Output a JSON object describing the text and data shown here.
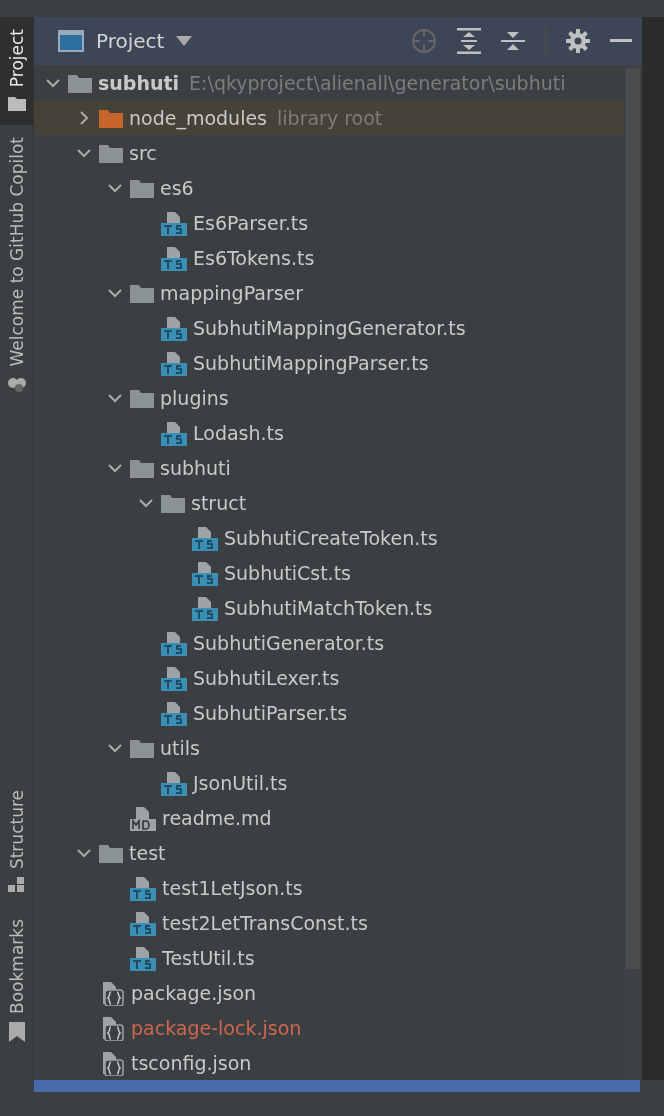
{
  "side_tabs_top": [
    {
      "label": "Project",
      "selected": true
    },
    {
      "label": "Welcome to GitHub Copilot",
      "selected": false
    }
  ],
  "side_tabs_bottom": [
    {
      "label": "Structure",
      "selected": false
    },
    {
      "label": "Bookmarks",
      "selected": false
    }
  ],
  "panel": {
    "title": "Project"
  },
  "tree": [
    {
      "kind": "folder",
      "name": "subhuti",
      "bold": true,
      "hint": "E:\\qkyproject\\alienall\\generator\\subhuti",
      "expanded": true,
      "children": [
        {
          "kind": "library",
          "name": "node_modules",
          "hint": "library root",
          "expanded": false,
          "highlighted": true
        },
        {
          "kind": "folder",
          "name": "src",
          "expanded": true,
          "children": [
            {
              "kind": "folder",
              "name": "es6",
              "expanded": true,
              "children": [
                {
                  "kind": "ts",
                  "name": "Es6Parser.ts"
                },
                {
                  "kind": "ts",
                  "name": "Es6Tokens.ts"
                }
              ]
            },
            {
              "kind": "folder",
              "name": "mappingParser",
              "expanded": true,
              "children": [
                {
                  "kind": "ts",
                  "name": "SubhutiMappingGenerator.ts"
                },
                {
                  "kind": "ts",
                  "name": "SubhutiMappingParser.ts"
                }
              ]
            },
            {
              "kind": "folder",
              "name": "plugins",
              "expanded": true,
              "children": [
                {
                  "kind": "ts",
                  "name": "Lodash.ts"
                }
              ]
            },
            {
              "kind": "folder",
              "name": "subhuti",
              "expanded": true,
              "children": [
                {
                  "kind": "folder",
                  "name": "struct",
                  "expanded": true,
                  "children": [
                    {
                      "kind": "ts",
                      "name": "SubhutiCreateToken.ts"
                    },
                    {
                      "kind": "ts",
                      "name": "SubhutiCst.ts"
                    },
                    {
                      "kind": "ts",
                      "name": "SubhutiMatchToken.ts"
                    }
                  ]
                },
                {
                  "kind": "ts",
                  "name": "SubhutiGenerator.ts"
                },
                {
                  "kind": "ts",
                  "name": "SubhutiLexer.ts"
                },
                {
                  "kind": "ts",
                  "name": "SubhutiParser.ts"
                }
              ]
            },
            {
              "kind": "folder",
              "name": "utils",
              "expanded": true,
              "children": [
                {
                  "kind": "ts",
                  "name": "JsonUtil.ts"
                }
              ]
            },
            {
              "kind": "md",
              "name": "readme.md"
            }
          ]
        },
        {
          "kind": "folder",
          "name": "test",
          "expanded": true,
          "children": [
            {
              "kind": "ts",
              "name": "test1LetJson.ts"
            },
            {
              "kind": "ts",
              "name": "test2LetTransConst.ts"
            },
            {
              "kind": "ts",
              "name": "TestUtil.ts"
            }
          ]
        },
        {
          "kind": "json",
          "name": "package.json"
        },
        {
          "kind": "json",
          "name": "package-lock.json",
          "color": "#d0664e"
        },
        {
          "kind": "json",
          "name": "tsconfig.json"
        }
      ]
    }
  ]
}
